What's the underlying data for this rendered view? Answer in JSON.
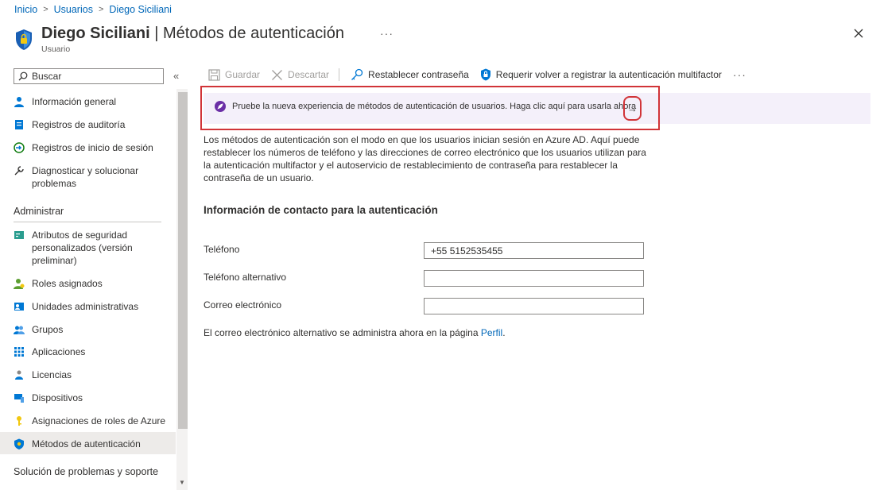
{
  "breadcrumb": [
    "Inicio",
    "Usuarios",
    "Diego Siciliani"
  ],
  "header": {
    "name": "Diego Siciliani",
    "separator": " | ",
    "page": "Métodos de autenticación",
    "subtitle": "Usuario",
    "more": "···"
  },
  "sidebar": {
    "search_placeholder": "Buscar",
    "collapse": "«",
    "items": [
      {
        "label": "Información general",
        "icon": "user-info-icon"
      },
      {
        "label": "Registros de auditoría",
        "icon": "audit-log-icon"
      },
      {
        "label": "Registros de inicio de sesión",
        "icon": "sign-in-icon"
      },
      {
        "label": "Diagnosticar y solucionar problemas",
        "icon": "wrench-icon"
      }
    ],
    "section_manage": "Administrar",
    "manage_items": [
      {
        "label": "Atributos de seguridad personalizados (versión preliminar)",
        "icon": "attributes-icon"
      },
      {
        "label": "Roles asignados",
        "icon": "roles-icon"
      },
      {
        "label": "Unidades administrativas",
        "icon": "admin-units-icon"
      },
      {
        "label": "Grupos",
        "icon": "groups-icon"
      },
      {
        "label": "Aplicaciones",
        "icon": "apps-grid-icon"
      },
      {
        "label": "Licencias",
        "icon": "licenses-icon"
      },
      {
        "label": "Dispositivos",
        "icon": "devices-icon"
      },
      {
        "label": "Asignaciones de roles de Azure",
        "icon": "key-icon"
      },
      {
        "label": "Métodos de autenticación",
        "icon": "shield-icon"
      }
    ],
    "section_support": "Solución de problemas y soporte"
  },
  "toolbar": {
    "save": "Guardar",
    "discard": "Descartar",
    "reset_password": "Restablecer contraseña",
    "require_mfa": "Requerir volver a registrar la autenticación multifactor",
    "more": "···"
  },
  "banner": {
    "text": "Pruebe la nueva experiencia de métodos de autenticación de usuarios. Haga clic aquí para usarla ahora",
    "arrow": "→"
  },
  "description": "Los métodos de autenticación son el modo en que los usuarios inician sesión en Azure AD. Aquí puede restablecer los números de teléfono y las direcciones de correo electrónico que los usuarios utilizan para la autenticación multifactor y el autoservicio de restablecimiento de contraseña para restablecer la contraseña de un usuario.",
  "contact": {
    "title": "Información de contacto para la autenticación",
    "phone_label": "Teléfono",
    "phone_value": "+55 5152535455",
    "alt_phone_label": "Teléfono alternativo",
    "alt_phone_value": "",
    "email_label": "Correo electrónico",
    "email_value": "",
    "note_prefix": "El correo electrónico alternativo se administra ahora en la página ",
    "note_link": "Perfil",
    "note_suffix": "."
  }
}
